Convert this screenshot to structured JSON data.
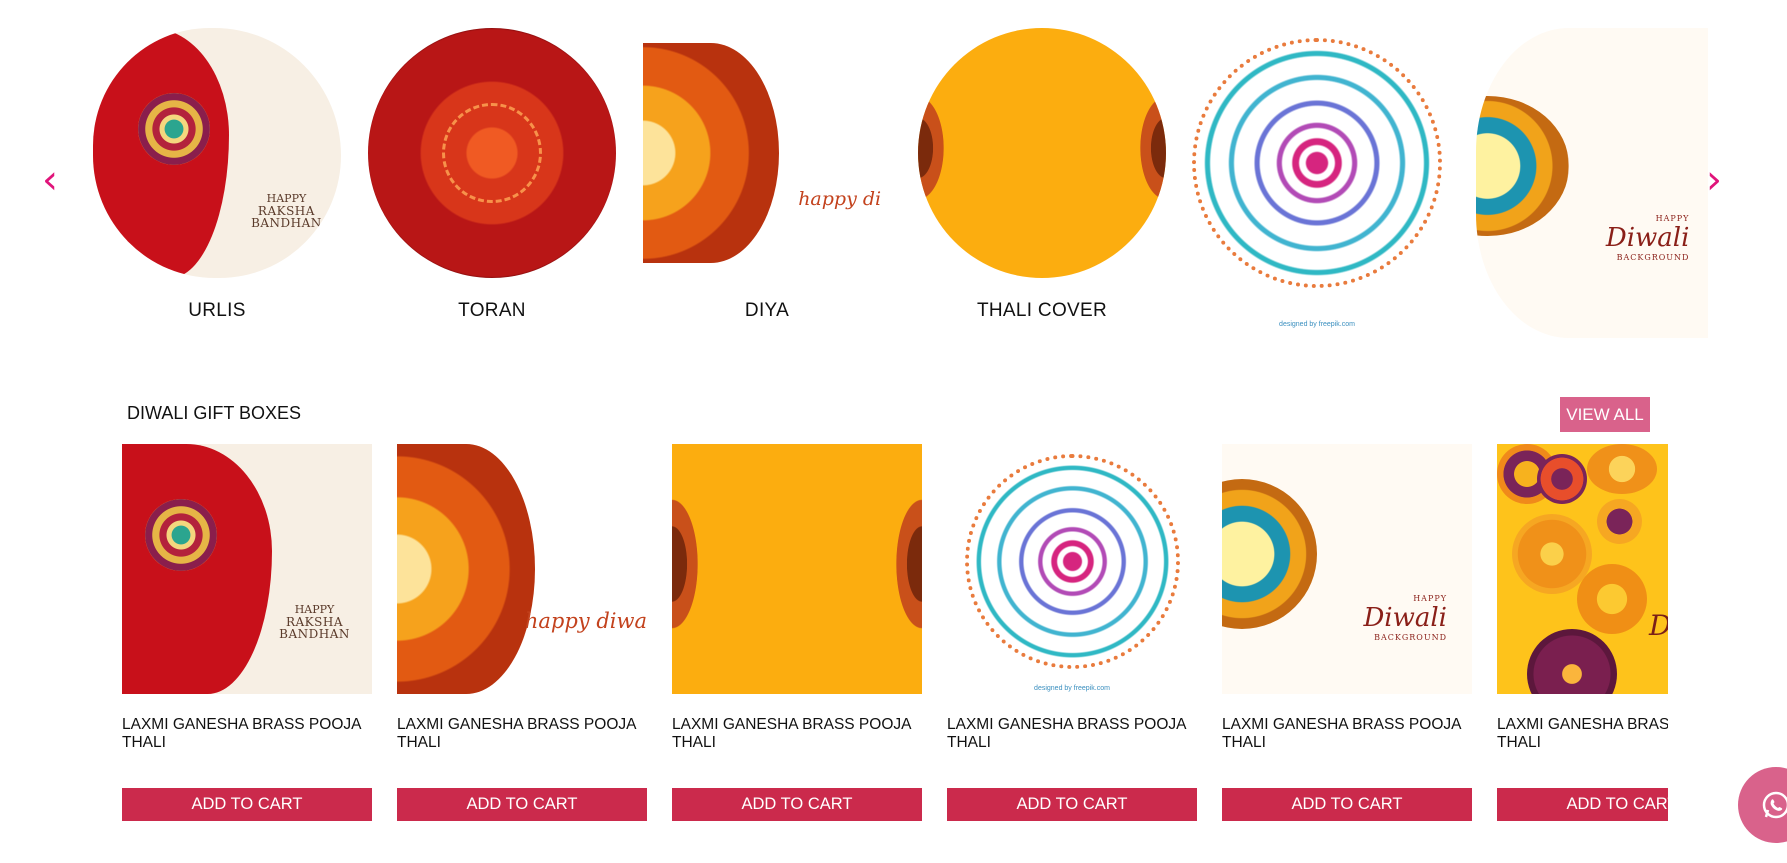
{
  "carousel": {
    "prev_icon": "chevron-left-icon",
    "next_icon": "chevron-right-icon",
    "prev_glyph": "‹",
    "next_glyph": "›",
    "items": [
      {
        "label": "URLIS",
        "image": "raksha-bandhan",
        "art_text_small": "HAPPY",
        "art_text_big": "RAKSHA BANDHAN"
      },
      {
        "label": "TORAN",
        "image": "red-mandala"
      },
      {
        "label": "DIYA",
        "image": "happy-diwali-mandala",
        "art_text": "happy di"
      },
      {
        "label": "THALI COVER",
        "image": "orange-pattern"
      },
      {
        "label": "",
        "image": "rainbow-mandala",
        "credit": "designed by freepik.com"
      },
      {
        "label": "",
        "image": "diwali-background",
        "art_text_small": "HAPPY",
        "art_text_big": "Diwali",
        "art_text_sub": "BACKGROUND"
      }
    ]
  },
  "section": {
    "title": "DIWALI GIFT BOXES",
    "view_all": "VIEW ALL"
  },
  "products": [
    {
      "name_line1": "LAXMI GANESHA BRASS POOJA",
      "name_line2": "THALI",
      "button": "ADD TO CART",
      "image": "raksha-bandhan",
      "art_text_small": "HAPPY",
      "art_text_big": "RAKSHA BANDHAN"
    },
    {
      "name_line1": "LAXMI GANESHA BRASS POOJA",
      "name_line2": "THALI",
      "button": "ADD TO CART",
      "image": "happy-diwali-mandala",
      "art_text": "happy diwa"
    },
    {
      "name_line1": "LAXMI GANESHA BRASS POOJA",
      "name_line2": "THALI",
      "button": "ADD TO CART",
      "image": "orange-pattern"
    },
    {
      "name_line1": "LAXMI GANESHA BRASS POOJA",
      "name_line2": "THALI",
      "button": "ADD TO CART",
      "image": "rainbow-mandala",
      "credit": "designed by freepik.com"
    },
    {
      "name_line1": "LAXMI GANESHA BRASS POOJA",
      "name_line2": "THALI",
      "button": "ADD TO CART",
      "image": "diwali-background",
      "art_text_small": "HAPPY",
      "art_text_big": "Diwali",
      "art_text_sub": "BACKGROUND"
    },
    {
      "name_line1": "LAXMI GANESHA BRASS POOJA",
      "name_line2": "THALI",
      "button": "ADD TO CART",
      "image": "yellow-flowers",
      "art_text": "Di"
    }
  ],
  "chat": {
    "icon": "whatsapp-icon"
  },
  "colors": {
    "accent_pink": "#e0147a",
    "view_all_bg": "#d9628b",
    "add_to_cart_bg": "#cb2a4c",
    "chat_bg": "#d9628b"
  }
}
